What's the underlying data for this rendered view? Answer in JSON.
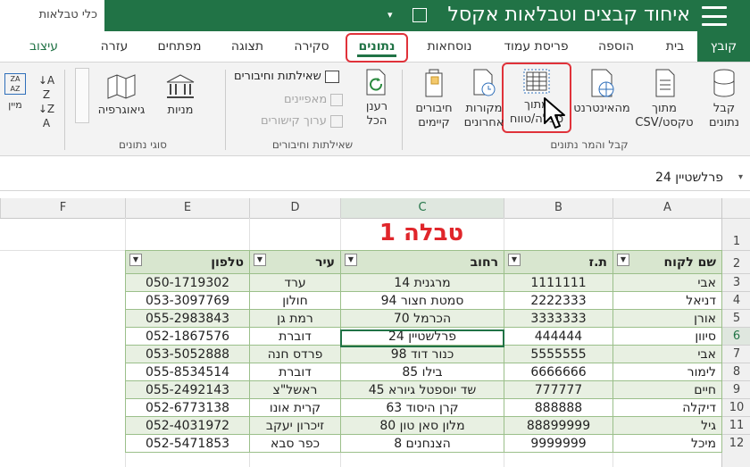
{
  "titlebar": {
    "context_tab": "כלי טבלאות",
    "doc_title": "איחוד קבצים וטבלאות אקסל"
  },
  "tabs": [
    {
      "id": "file",
      "label": "קובץ"
    },
    {
      "id": "home",
      "label": "בית"
    },
    {
      "id": "insert",
      "label": "הוספה"
    },
    {
      "id": "layout",
      "label": "פריסת עמוד"
    },
    {
      "id": "formulas",
      "label": "נוסחאות"
    },
    {
      "id": "data",
      "label": "נתונים"
    },
    {
      "id": "review",
      "label": "סקירה"
    },
    {
      "id": "view",
      "label": "תצוגה"
    },
    {
      "id": "developer",
      "label": "מפתחים"
    },
    {
      "id": "help",
      "label": "עזרה"
    },
    {
      "id": "design",
      "label": "עיצוב"
    }
  ],
  "ribbon": {
    "get_data": "קבל\nנתונים",
    "from_text": "מתוך\nטקסט/CSV",
    "from_web": "מהאינטרנט",
    "from_table": "מתוך\nטבלה/טווח",
    "recent_sources": "מקורות\nאחרונים",
    "existing_connections": "חיבורים\nקיימים",
    "group_get_transform": "קבל והמר נתונים",
    "refresh_all": "רענן\nהכל",
    "queries_connections": "שאילתות וחיבורים",
    "properties": "מאפיינים",
    "edit_links": "ערוך קישורים",
    "group_queries": "שאילתות וחיבורים",
    "stocks": "מניות",
    "geography": "גיאוגרפיה",
    "group_data_types": "סוגי נתונים",
    "sort": "מיין"
  },
  "formula_bar": {
    "cell_value": "פרלשטיין 24"
  },
  "columns": [
    "A",
    "B",
    "C",
    "D",
    "E",
    "F"
  ],
  "rows": [
    "1",
    "2",
    "3",
    "4",
    "5",
    "6",
    "7",
    "8",
    "9",
    "10",
    "11",
    "12"
  ],
  "sheet": {
    "table_title": "טבלה 1",
    "headers": [
      "שם לקוח",
      "ת.ז",
      "רחוב",
      "עיר",
      "טלפון"
    ],
    "data": [
      [
        "אבי",
        "1111111",
        "מרגנית 14",
        "ערד",
        "050-1719302"
      ],
      [
        "דניאל",
        "2222333",
        "סמטת חצור 94",
        "חולון",
        "053-3097769"
      ],
      [
        "אורן",
        "3333333",
        "הכרמל 70",
        "רמת גן",
        "055-2983843"
      ],
      [
        "סיוון",
        "444444",
        "פרלשטיין 24",
        "דוברת",
        "052-1867576"
      ],
      [
        "אבי",
        "5555555",
        "כנור דוד 98",
        "פרדס חנה",
        "053-5052888"
      ],
      [
        "לימור",
        "6666666",
        "בילו 85",
        "דוברת",
        "055-8534514"
      ],
      [
        "חיים",
        "777777",
        "שד יוספטל גיורא 45",
        "ראשל\"צ",
        "055-2492143"
      ],
      [
        "דיקלה",
        "888888",
        "קרן היסוד 63",
        "קרית אונו",
        "052-6773138"
      ],
      [
        "גיל",
        "88899999",
        "מלון סאן טון 80",
        "זיכרון יעקב",
        "052-4031972"
      ],
      [
        "מיכל",
        "9999999",
        "הצנחנים 8",
        "כפר סבא",
        "052-5471853"
      ]
    ]
  },
  "colors": {
    "accent": "#217346",
    "highlight": "#e0323a",
    "title_red": "#e0262b",
    "band": "#e8f0e2",
    "header": "#d8e6cf"
  }
}
